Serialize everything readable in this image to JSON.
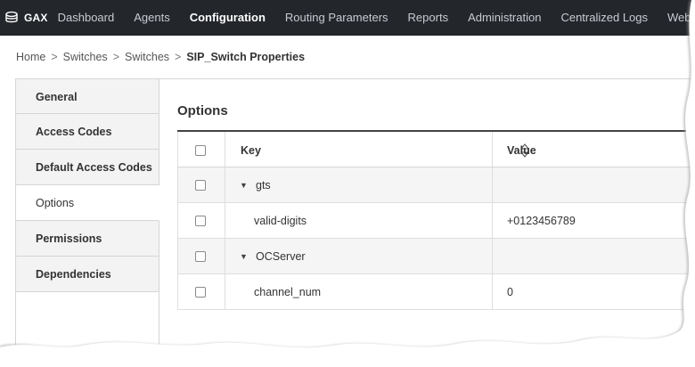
{
  "topbar": {
    "brand": "GAX",
    "nav": [
      {
        "label": "Dashboard",
        "active": false
      },
      {
        "label": "Agents",
        "active": false
      },
      {
        "label": "Configuration",
        "active": true
      },
      {
        "label": "Routing Parameters",
        "active": false
      },
      {
        "label": "Reports",
        "active": false
      },
      {
        "label": "Administration",
        "active": false
      },
      {
        "label": "Centralized Logs",
        "active": false
      },
      {
        "label": "Web Er",
        "active": false
      }
    ]
  },
  "breadcrumb": {
    "items": [
      "Home",
      "Switches",
      "Switches"
    ],
    "separator": ">",
    "current": "SIP_Switch Properties"
  },
  "sidebar": {
    "items": [
      {
        "label": "General",
        "active": false
      },
      {
        "label": "Access Codes",
        "active": false
      },
      {
        "label": "Default Access Codes",
        "active": false
      },
      {
        "label": "Options",
        "active": true
      },
      {
        "label": "Permissions",
        "active": false
      },
      {
        "label": "Dependencies",
        "active": false
      }
    ]
  },
  "content": {
    "title": "Options",
    "table": {
      "headers": {
        "key": "Key",
        "value": "Value"
      },
      "rows": [
        {
          "type": "group",
          "key": "gts",
          "value": ""
        },
        {
          "type": "item",
          "key": "valid-digits",
          "value": "+0123456789"
        },
        {
          "type": "group",
          "key": "OCServer",
          "value": ""
        },
        {
          "type": "item",
          "key": "channel_num",
          "value": "0"
        }
      ]
    }
  },
  "icons": {
    "brand": "stack-icon",
    "sort": "sort-icon",
    "expand": "triangle-down-icon"
  },
  "colors": {
    "topbar_bg": "#23262b",
    "group_row_bg": "#f5f5f5",
    "sidebar_bg": "#f3f3f3"
  }
}
